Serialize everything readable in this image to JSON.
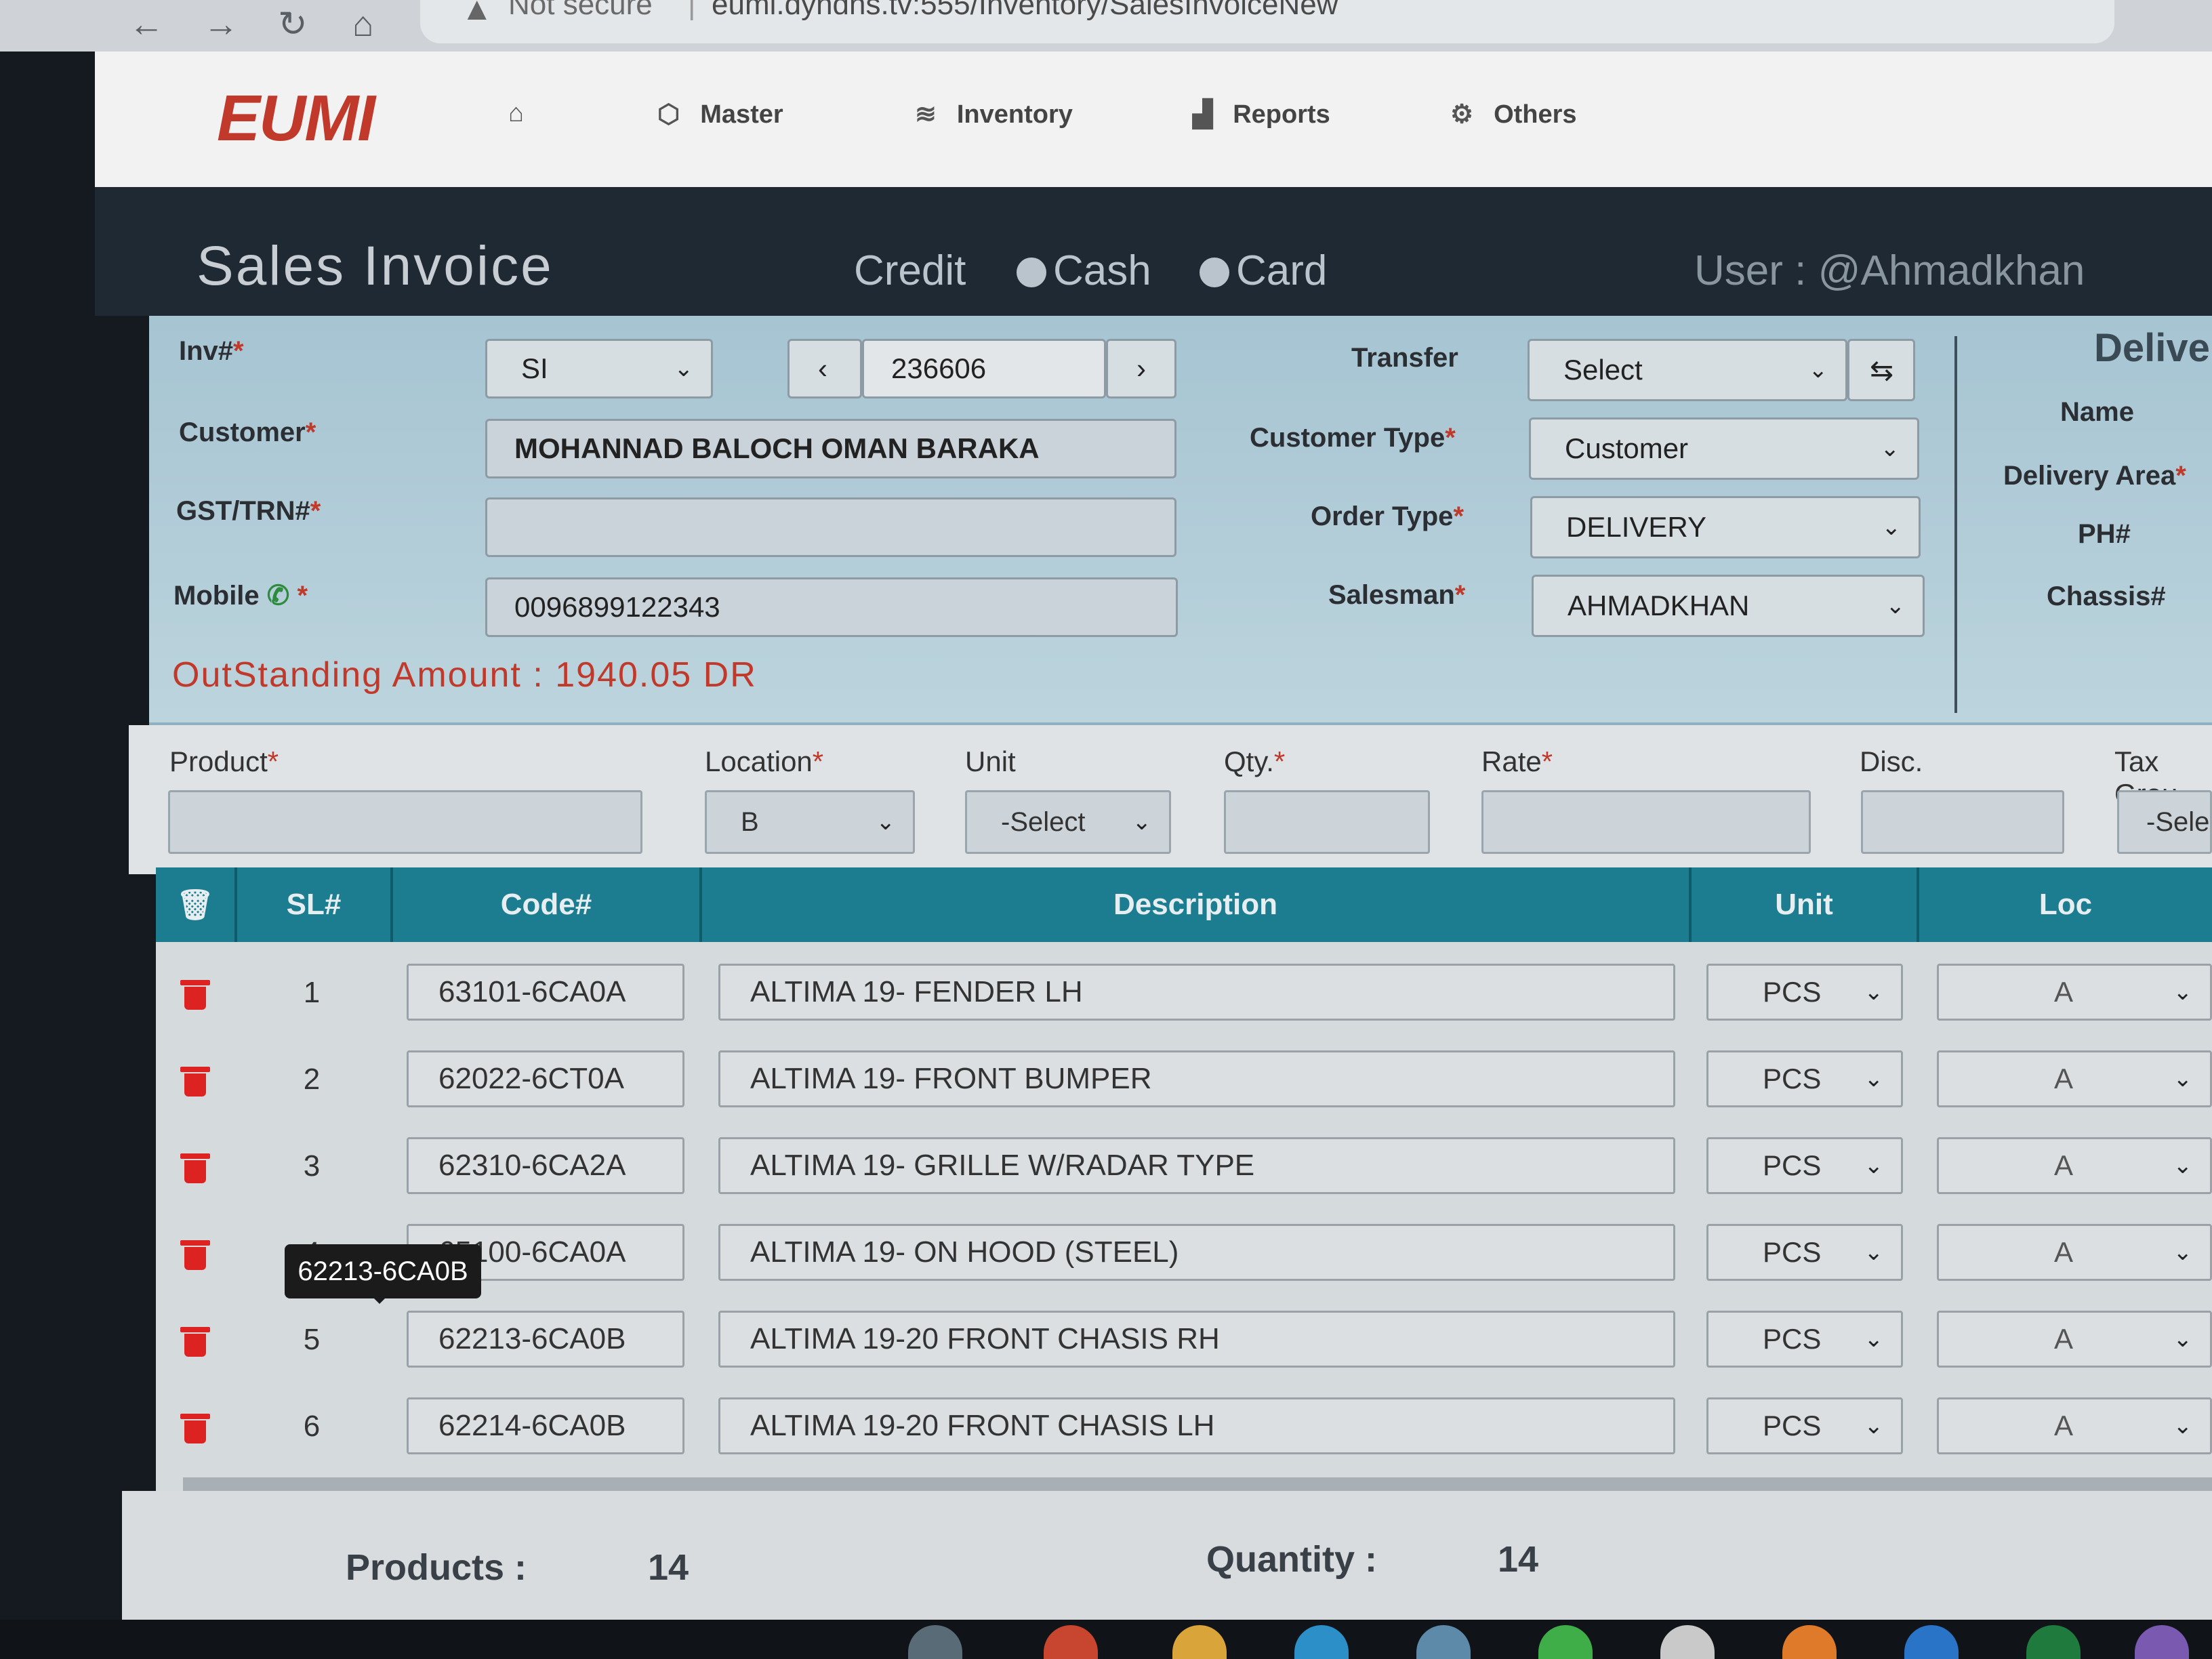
{
  "browser": {
    "security": "Not secure",
    "url": "eumi.dyndns.tv:555/Inventory/SalesInvoiceNew"
  },
  "nav": {
    "logo": "EUMI",
    "items": [
      {
        "label": "",
        "icon": "home-icon"
      },
      {
        "label": "Master",
        "icon": "cube-icon"
      },
      {
        "label": "Inventory",
        "icon": "layers-icon"
      },
      {
        "label": "Reports",
        "icon": "bar-chart-icon"
      },
      {
        "label": "Others",
        "icon": "gear-icon"
      }
    ]
  },
  "header": {
    "title": "Sales Invoice",
    "payment_types": [
      "Credit",
      "Cash",
      "Card"
    ],
    "user": "User : @Ahmadkhan"
  },
  "form": {
    "inv_label": "Inv#",
    "inv_prefix": "SI",
    "inv_number": "236606",
    "customer_label": "Customer",
    "customer": "MOHANNAD BALOCH OMAN BARAKA",
    "gst_label": "GST/TRN#",
    "gst": "",
    "mobile_label": "Mobile",
    "mobile": "0096899122343",
    "outstanding": "OutStanding Amount : 1940.05 DR",
    "transfer_label": "Transfer",
    "transfer": "Select",
    "customer_type_label": "Customer Type",
    "customer_type": "Customer",
    "order_type_label": "Order Type",
    "order_type": "DELIVERY",
    "salesman_label": "Salesman",
    "salesman": "AHMADKHAN"
  },
  "delivery": {
    "title": "Delive",
    "name_label": "Name",
    "area_label": "Delivery Area",
    "ph_label": "PH#",
    "chassis_label": "Chassis#"
  },
  "entry": {
    "product_label": "Product",
    "location_label": "Location",
    "location": "B",
    "unit_label": "Unit",
    "unit": "-Select",
    "qty_label": "Qty.",
    "rate_label": "Rate",
    "disc_label": "Disc.",
    "tax_label": "Tax Grou",
    "tax": "-Sele"
  },
  "table": {
    "headers": [
      "SL#",
      "Code#",
      "Description",
      "Unit",
      "Loc"
    ],
    "rows": [
      {
        "sl": "1",
        "code": "63101-6CA0A",
        "desc": "ALTIMA 19- FENDER LH",
        "unit": "PCS",
        "loc": "A"
      },
      {
        "sl": "2",
        "code": "62022-6CT0A",
        "desc": "ALTIMA 19- FRONT BUMPER",
        "unit": "PCS",
        "loc": "A"
      },
      {
        "sl": "3",
        "code": "62310-6CA2A",
        "desc": "ALTIMA 19- GRILLE W/RADAR TYPE",
        "unit": "PCS",
        "loc": "A"
      },
      {
        "sl": "4",
        "code": "65100-6CA0A",
        "desc": "ALTIMA 19- ON HOOD (STEEL)",
        "unit": "PCS",
        "loc": "A"
      },
      {
        "sl": "5",
        "code": "62213-6CA0B",
        "desc": "ALTIMA 19-20 FRONT CHASIS RH",
        "unit": "PCS",
        "loc": "A"
      },
      {
        "sl": "6",
        "code": "62214-6CA0B",
        "desc": "ALTIMA 19-20 FRONT CHASIS LH",
        "unit": "PCS",
        "loc": "A"
      }
    ],
    "tooltip": "62213-6CA0B"
  },
  "footer": {
    "products_label": "Products :",
    "products": "14",
    "quantity_label": "Quantity :",
    "quantity": "14"
  }
}
